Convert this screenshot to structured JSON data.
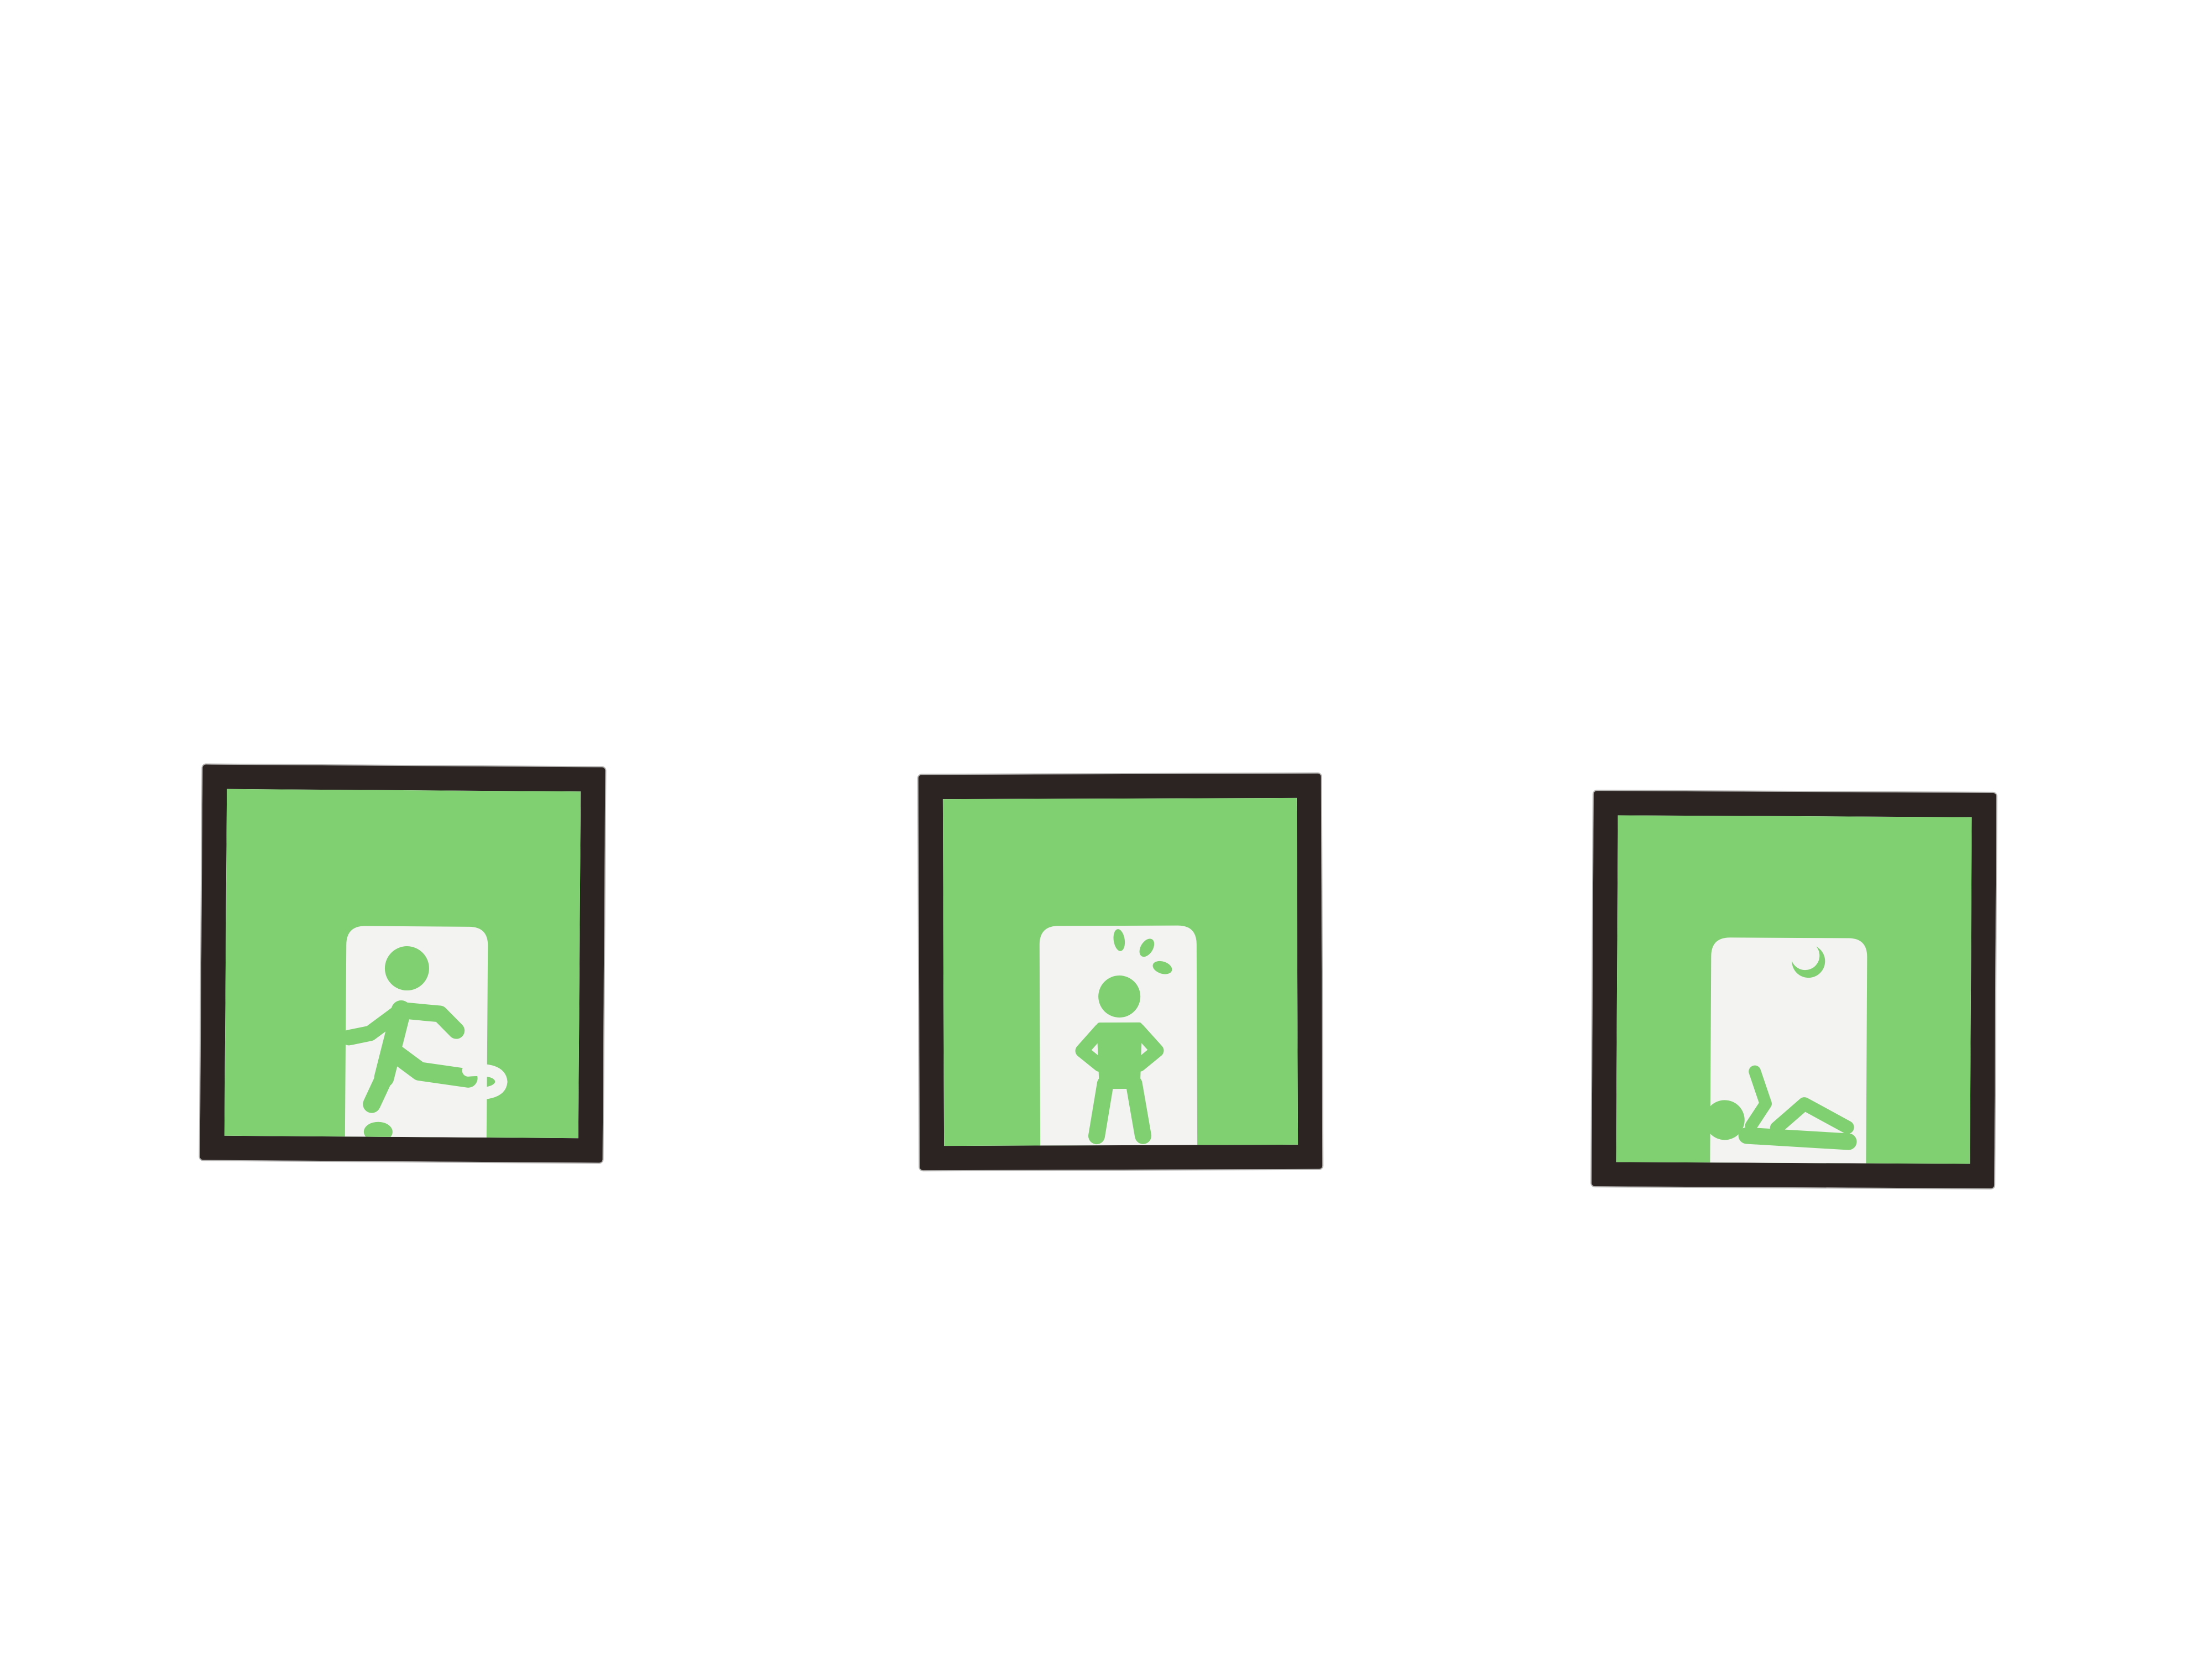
{
  "colors": {
    "background": "#ffffff",
    "frame": "#2b2423",
    "panel": "#80d072",
    "door": "#f3f3f1",
    "figure": "#80d072"
  },
  "signs": [
    {
      "icon": "running-person-exit-icon"
    },
    {
      "icon": "alarmed-standing-person-icon"
    },
    {
      "icon": "sleeping-person-moon-icon"
    }
  ]
}
